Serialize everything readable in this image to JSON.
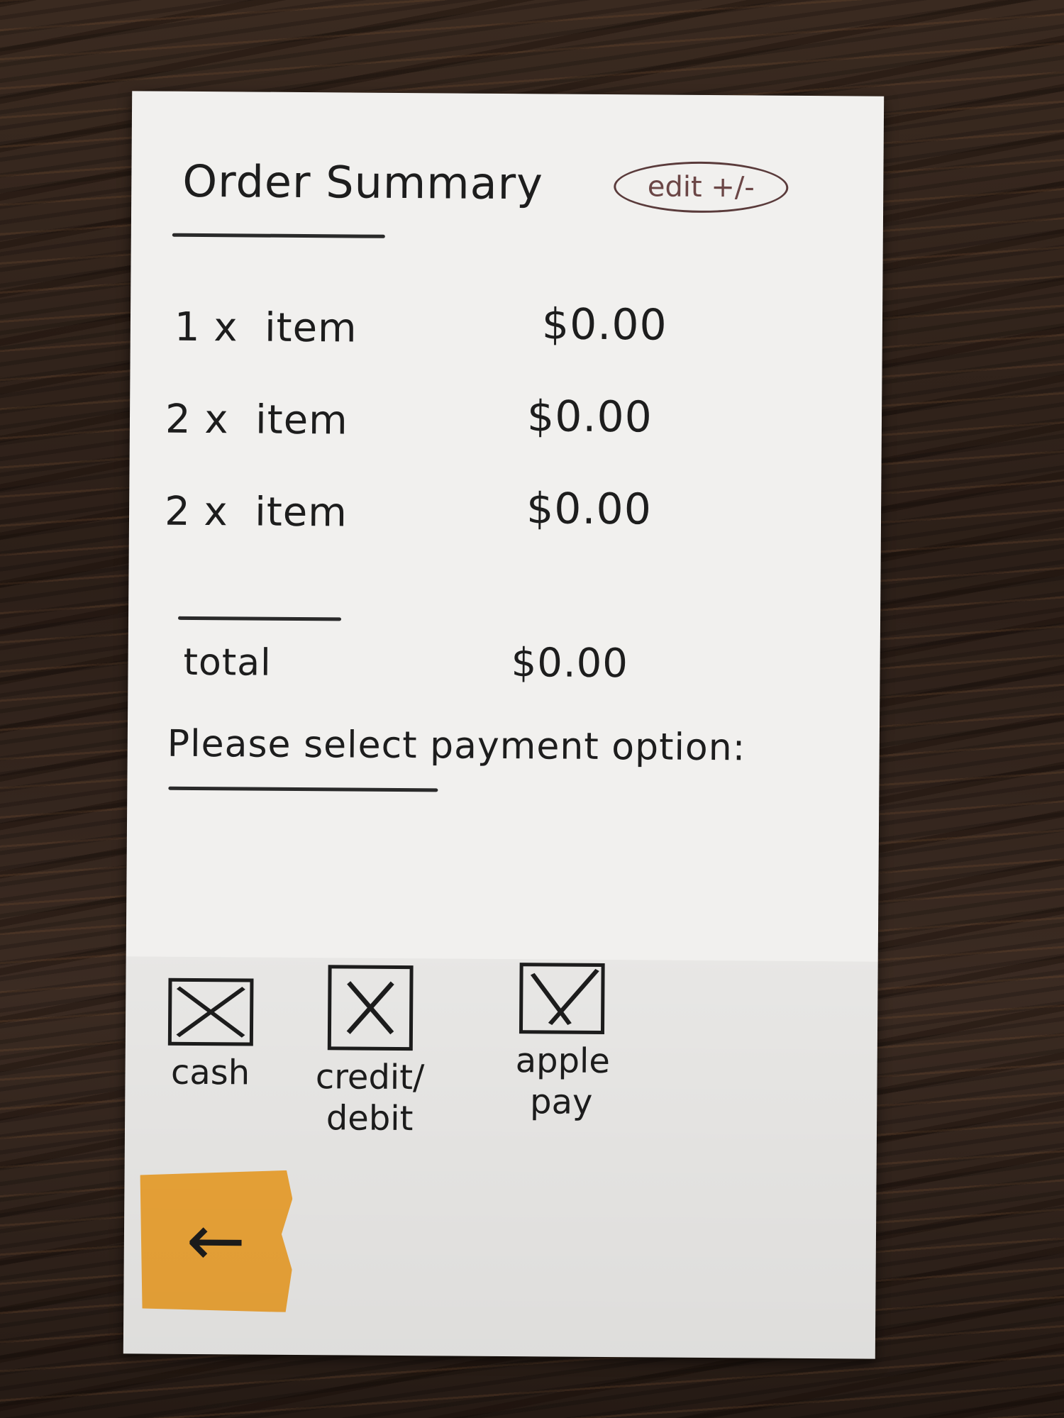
{
  "header": {
    "title": "Order Summary",
    "edit_label": "edit +/-"
  },
  "items": [
    {
      "qty": "1 x",
      "name": "item",
      "price": "$0.00"
    },
    {
      "qty": "2 x",
      "name": "item",
      "price": "$0.00"
    },
    {
      "qty": "2 x",
      "name": "item",
      "price": "$0.00"
    }
  ],
  "total": {
    "label": "total",
    "value": "$0.00"
  },
  "payment": {
    "prompt": "Please select payment option:",
    "options": [
      {
        "label": "cash"
      },
      {
        "label": "credit/ debit"
      },
      {
        "label": "apple pay"
      }
    ]
  },
  "nav": {
    "back_icon": "arrow-left-icon",
    "back_glyph": "←"
  },
  "colors": {
    "paper": "#f1f0ee",
    "ink": "#1d1d1d",
    "back_button": "#f2a93a"
  }
}
